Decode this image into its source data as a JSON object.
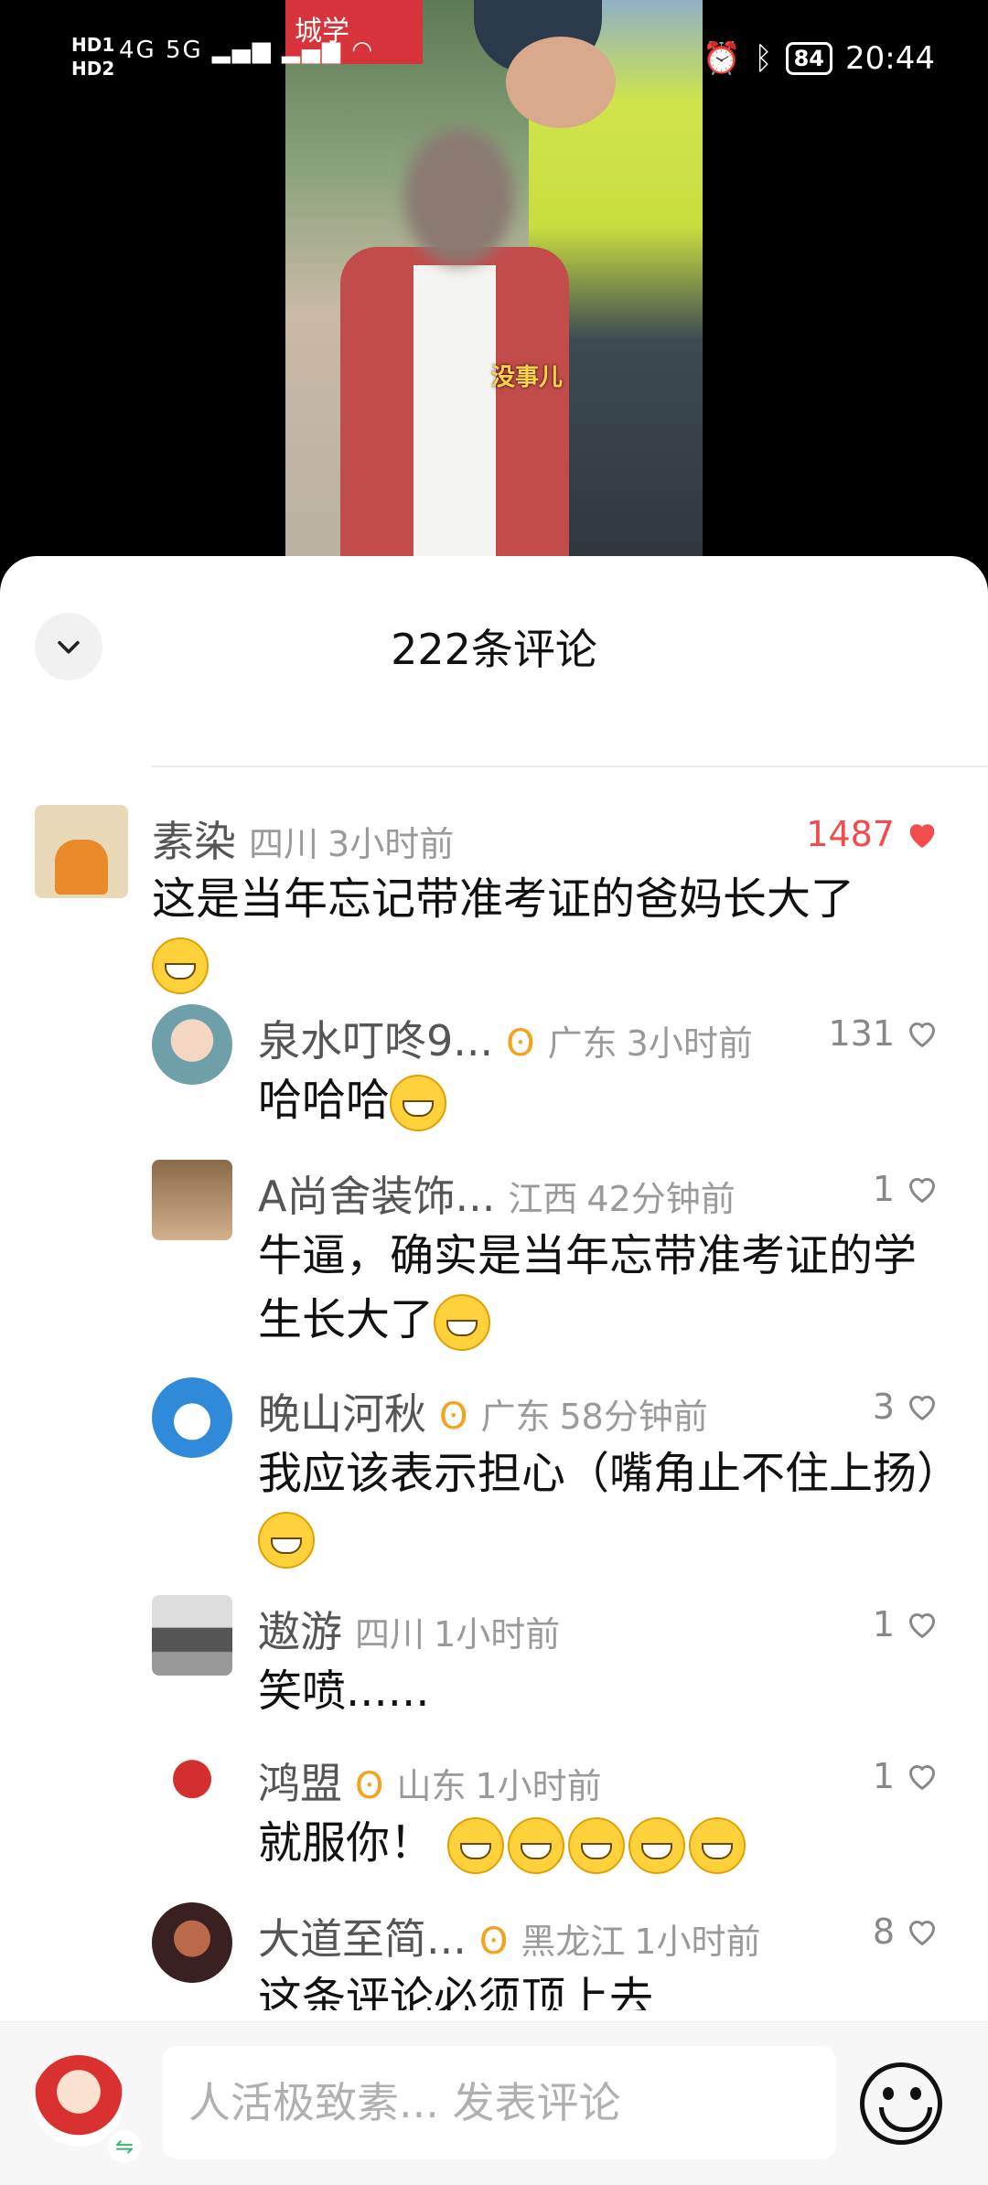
{
  "status_bar": {
    "hd_labels": [
      "HD1",
      "HD2"
    ],
    "network": "4G 5G",
    "battery": "84",
    "time": "20:44"
  },
  "video": {
    "banner_text": "城学",
    "subtitle": "没事儿"
  },
  "sheet": {
    "title": "222条评论"
  },
  "comments": [
    {
      "name": "素染",
      "location": "四川",
      "time": "3小时前",
      "likes": "1487",
      "liked": true,
      "text": "这是当年忘记带准考证的爸妈长大了"
    },
    {
      "name": "泉水叮咚9...",
      "badge": "ʘ",
      "location": "广东",
      "time": "3小时前",
      "likes": "131",
      "text": "哈哈哈"
    },
    {
      "name": "A尚舍装饰...",
      "location": "江西",
      "time": "42分钟前",
      "likes": "1",
      "text": "牛逼，确实是当年忘带准考证的学生长大了"
    },
    {
      "name": "晚山河秋",
      "badge": "ʘ",
      "location": "广东",
      "time": "58分钟前",
      "likes": "3",
      "text": "我应该表示担心（嘴角止不住上扬）"
    },
    {
      "name": "遨游",
      "location": "四川",
      "time": "1小时前",
      "likes": "1",
      "text": "笑喷......"
    },
    {
      "name": "鸿盟",
      "badge": "ʘ",
      "location": "山东",
      "time": "1小时前",
      "likes": "1",
      "text": "就服你！"
    },
    {
      "name": "大道至简...",
      "badge": "ʘ",
      "location": "黑龙江",
      "time": "1小时前",
      "likes": "8",
      "text": "这条评论必须顶上去"
    }
  ],
  "bottom_bar": {
    "placeholder": "人活极致素... 发表评论",
    "sync_icon": "⇋"
  },
  "colors": {
    "accent_like": "#f24b4b",
    "badge": "#f2a320"
  }
}
